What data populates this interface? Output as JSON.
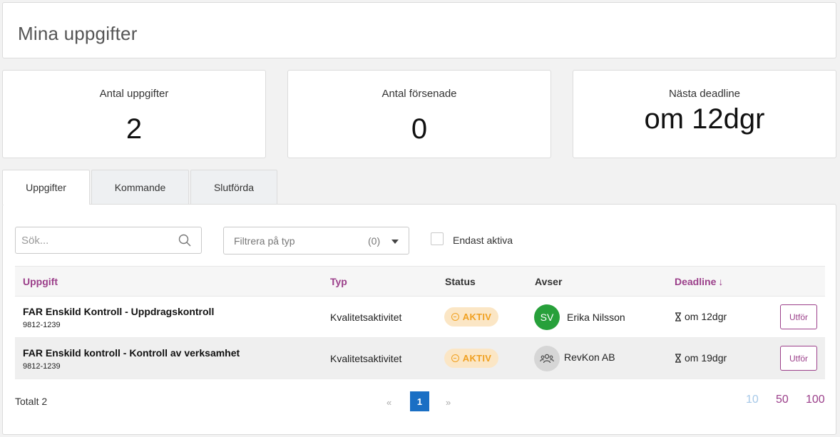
{
  "header": {
    "title": "Mina uppgifter"
  },
  "stats": [
    {
      "label": "Antal uppgifter",
      "value": "2"
    },
    {
      "label": "Antal försenade",
      "value": "0"
    },
    {
      "label": "Nästa deadline",
      "value": "om 12dgr"
    }
  ],
  "tabs": [
    {
      "label": "Uppgifter",
      "active": true
    },
    {
      "label": "Kommande",
      "active": false
    },
    {
      "label": "Slutförda",
      "active": false
    }
  ],
  "filters": {
    "search_placeholder": "Sök...",
    "type_placeholder": "Filtrera på typ",
    "type_count": "(0)",
    "only_active_label": "Endast aktiva"
  },
  "table": {
    "columns": {
      "uppgift": "Uppgift",
      "typ": "Typ",
      "status": "Status",
      "avser": "Avser",
      "deadline": "Deadline",
      "sort_arrow": "↓"
    },
    "rows": [
      {
        "title": "FAR Enskild Kontroll - Uppdragskontroll",
        "id": "9812-1239",
        "type": "Kvalitetsaktivitet",
        "status": "AKTIV",
        "avatar_initials": "SV",
        "avser": "Erika Nilsson",
        "deadline": "om 12dgr",
        "action": "Utför"
      },
      {
        "title": "FAR Enskild kontroll - Kontroll av verksamhet",
        "id": "9812-1239",
        "type": "Kvalitetsaktivitet",
        "status": "AKTIV",
        "avatar_icon": "group-icon",
        "avser": "RevKon AB",
        "deadline": "om 19dgr",
        "action": "Utför"
      }
    ]
  },
  "footer": {
    "total": "Totalt 2",
    "prev": "«",
    "current_page": "1",
    "next": "»",
    "page_sizes": [
      "10",
      "50",
      "100"
    ]
  },
  "colors": {
    "accent": "#9b3f8a",
    "page_active": "#1a6fc4",
    "badge_bg": "#fbe6c5",
    "badge_text": "#f0a020",
    "avatar_green": "#27a03a"
  }
}
